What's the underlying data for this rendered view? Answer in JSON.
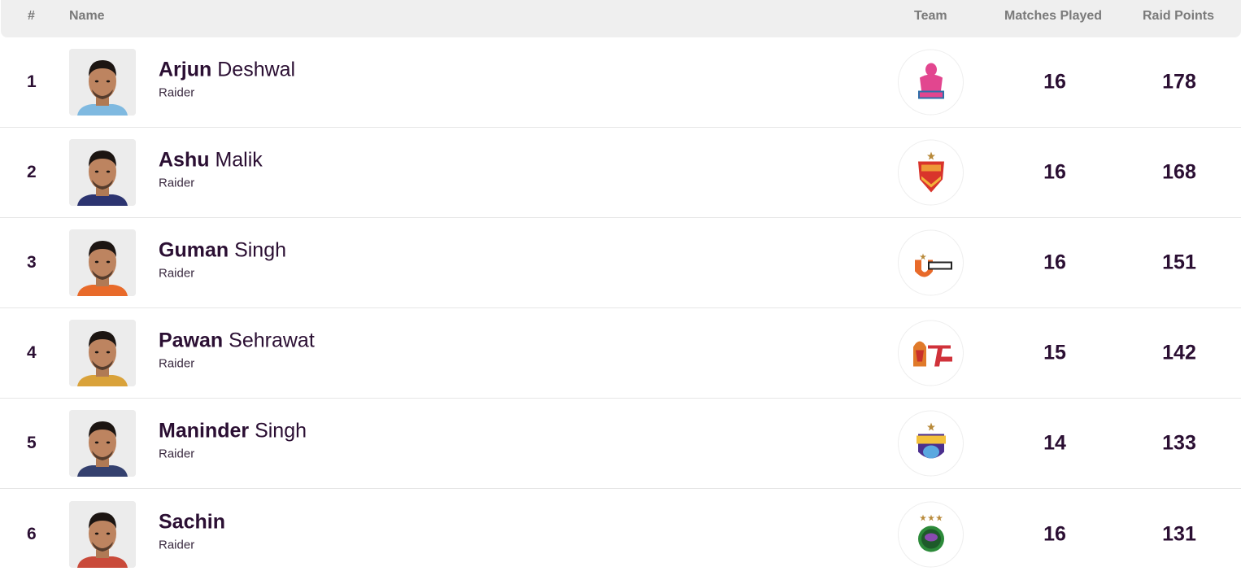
{
  "table": {
    "headers": {
      "rank": "#",
      "name": "Name",
      "team": "Team",
      "matches": "Matches Played",
      "points": "Raid Points"
    },
    "rows": [
      {
        "rank": "1",
        "first_name": "Arjun",
        "last_name": "Deshwal",
        "role": "Raider",
        "team": "Jaipur Pink Panthers",
        "team_icon": "pink-panthers-logo",
        "jersey_color": "#7fb9e0",
        "matches": "16",
        "points": "178"
      },
      {
        "rank": "2",
        "first_name": "Ashu",
        "last_name": "Malik",
        "role": "Raider",
        "team": "Dabang Delhi K.C.",
        "team_icon": "dabang-delhi-logo",
        "jersey_color": "#2c3470",
        "matches": "16",
        "points": "168"
      },
      {
        "rank": "3",
        "first_name": "Guman",
        "last_name": "Singh",
        "role": "Raider",
        "team": "U Mumba",
        "team_icon": "u-mumba-logo",
        "jersey_color": "#e86a2a",
        "matches": "16",
        "points": "151"
      },
      {
        "rank": "4",
        "first_name": "Pawan",
        "last_name": "Sehrawat",
        "role": "Raider",
        "team": "Telugu Titans",
        "team_icon": "telugu-titans-logo",
        "jersey_color": "#d9a23a",
        "matches": "15",
        "points": "142"
      },
      {
        "rank": "5",
        "first_name": "Maninder",
        "last_name": "Singh",
        "role": "Raider",
        "team": "Bengal Warriors",
        "team_icon": "bengal-warriors-logo",
        "jersey_color": "#34406e",
        "matches": "14",
        "points": "133"
      },
      {
        "rank": "6",
        "first_name": "Sachin",
        "last_name": "",
        "role": "Raider",
        "team": "Patna Pirates",
        "team_icon": "patna-pirates-logo",
        "jersey_color": "#c94a3a",
        "matches": "16",
        "points": "131"
      }
    ]
  }
}
